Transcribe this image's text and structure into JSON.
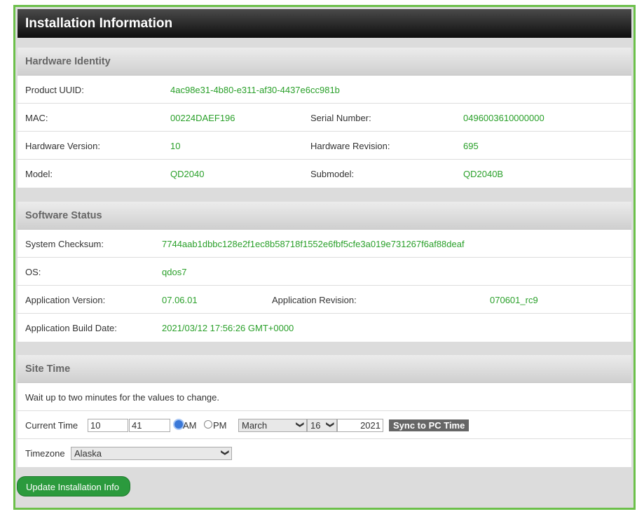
{
  "title": "Installation Information",
  "hardware": {
    "heading": "Hardware Identity",
    "uuid_label": "Product UUID:",
    "uuid": "4ac98e31-4b80-e311-af30-4437e6cc981b",
    "mac_label": "MAC:",
    "mac": "00224DAEF196",
    "serial_label": "Serial Number:",
    "serial": "0496003610000000",
    "hwver_label": "Hardware Version:",
    "hwver": "10",
    "hwrev_label": "Hardware Revision:",
    "hwrev": "695",
    "model_label": "Model:",
    "model": "QD2040",
    "submodel_label": "Submodel:",
    "submodel": "QD2040B"
  },
  "software": {
    "heading": "Software Status",
    "checksum_label": "System Checksum:",
    "checksum": "7744aab1dbbc128e2f1ec8b58718f1552e6fbf5cfe3a019e731267f6af88deaf",
    "os_label": "OS:",
    "os": "qdos7",
    "appver_label": "Application Version:",
    "appver": "07.06.01",
    "apprev_label": "Application Revision:",
    "apprev": "070601_rc9",
    "build_label": "Application Build Date:",
    "build": "2021/03/12 17:56:26 GMT+0000"
  },
  "site_time": {
    "heading": "Site Time",
    "note": "Wait up to two minutes for the values to change.",
    "current_label": "Current Time",
    "hour": "10",
    "minute": "41",
    "am": "AM",
    "pm": "PM",
    "meridiem": "AM",
    "month": "March",
    "day": "16",
    "year": "2021",
    "sync": "Sync to PC Time",
    "tz_label": "Timezone",
    "timezone": "Alaska"
  },
  "update_button": "Update Installation Info"
}
